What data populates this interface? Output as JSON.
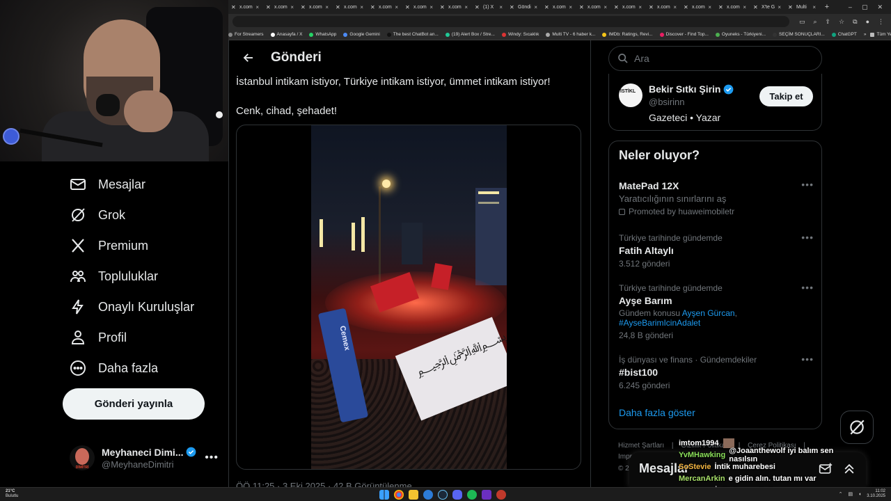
{
  "browser": {
    "tabs": [
      "x.com",
      "x.com",
      "x.com",
      "x.com",
      "x.com",
      "x.com",
      "x.com",
      "(1) X",
      "Göndi",
      "x.com",
      "x.com",
      "x.com",
      "x.com",
      "x.com",
      "x.com",
      "X'te G",
      "Multi"
    ],
    "new_tab": "+",
    "bookmarks": [
      "For Streamers",
      "Anasayfa / X",
      "WhatsApp",
      "Google Gemini",
      "The best ChatBot an...",
      "(19) Alert Box / Stre...",
      "Windy: Sıcaklık",
      "Multi TV - 6 haber k...",
      "IMDb: Ratings, Revi...",
      "Discover - Find Top...",
      "Oyuneks - Türkiyeni...",
      "SEÇİM SONUÇLARI...",
      "ChatGPT"
    ],
    "bookmarks_more": "»",
    "bookmarks_all": "Tüm Yer İşaretleri"
  },
  "nav": {
    "items": [
      {
        "label": "Mesajlar",
        "icon": "envelope-icon"
      },
      {
        "label": "Grok",
        "icon": "grok-icon"
      },
      {
        "label": "Premium",
        "icon": "x-logo-icon"
      },
      {
        "label": "Topluluklar",
        "icon": "people-icon"
      },
      {
        "label": "Onaylı Kuruluşlar",
        "icon": "lightning-icon"
      },
      {
        "label": "Profil",
        "icon": "person-icon"
      },
      {
        "label": "Daha fazla",
        "icon": "more-circle-icon"
      }
    ],
    "post_button": "Gönderi yayınla",
    "profile": {
      "name": "Meyhaneci Dimi...",
      "handle": "@MeyhaneDimitri",
      "more": "•••",
      "avatar_text": "DİMİTRİ"
    }
  },
  "main": {
    "title": "Gönderi",
    "tweet_lines": [
      "İstanbul intikam istiyor, Türkiye intikam istiyor, ümmet intikam istiyor!",
      "Cenk, cihad, şehadet!"
    ],
    "video_banner_text": "Cemex",
    "meta": "ÖÖ 11:25 · 3 Eki 2025 · 42 B Görüntülenme"
  },
  "right": {
    "search_placeholder": "Ara",
    "user": {
      "name": "Bekir Sıtkı Şirin",
      "handle": "@bsirinn",
      "bio": "Gazeteci • Yazar",
      "follow": "Takip et",
      "avatar_text": "İSTİKL"
    },
    "trends_title": "Neler oluyor?",
    "trends": [
      {
        "name": "MatePad 12X",
        "sub": "Yaratıcılığının sınırlarını aş",
        "promo": "Promoted by huaweimobiletr"
      },
      {
        "context": "Türkiye tarihinde gündemde",
        "name": "Fatih Altaylı",
        "count": "3.512 gönderi"
      },
      {
        "context": "Türkiye tarihinde gündemde",
        "name": "Ayşe Barım",
        "sub_prefix": "Gündem konusu",
        "link1": "Ayşen Gürcan",
        "link2": "#AyseBarimIcinAdalet",
        "count": "24,8 B gönderi"
      },
      {
        "context": "İş dünyası ve finans · Gündemdekiler",
        "name": "#bist100",
        "count": "6.245 gönderi"
      }
    ],
    "more_dots": "•••",
    "show_more": "Daha fazla göster",
    "footer": [
      "Hizmet Şartları",
      "|",
      "Gizlilik Politikası",
      "|",
      "Çerez Politikası",
      "|",
      "Impr",
      "© 2"
    ]
  },
  "messages_drawer": {
    "title": "Mesajlar"
  },
  "chat": [
    {
      "user": "imtom1994",
      "msg": "",
      "color": "#ffffff"
    },
    {
      "user": "YvMHawking",
      "msg": "@Joaanthewolf iyi balım sen nasılsın",
      "color": "#8be05a"
    },
    {
      "user": "SoStevie",
      "msg": "İntik muharebesi",
      "color": "#f5b642"
    },
    {
      "user": "MercanArkin",
      "msg": "e gidin alın. tutan mı var",
      "color": "#a8e06a"
    },
    {
      "user": "ozmancc",
      "msg": "İntik Am peşinde",
      "color": "#b06af0"
    }
  ],
  "taskbar": {
    "weather_temp": "21°C",
    "weather_desc": "Bulutlu",
    "time": "11:02",
    "date": "3.10.2025"
  },
  "colors": {
    "accent": "#1d9bf0",
    "background": "#000000",
    "border": "#2f3336",
    "text": "#e7e9ea",
    "muted": "#71767b"
  }
}
